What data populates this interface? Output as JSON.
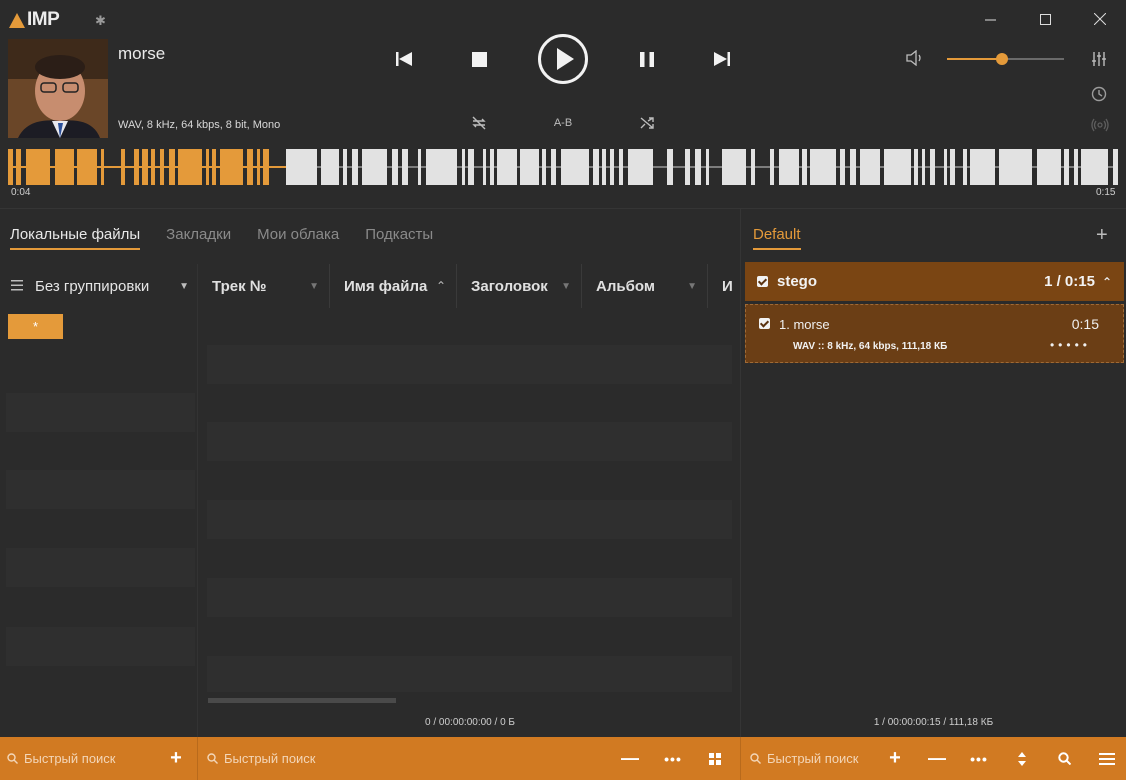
{
  "app": {
    "logo": "IMP",
    "window_controls": [
      "minimize",
      "maximize",
      "close"
    ]
  },
  "player": {
    "title": "morse",
    "info": "WAV, 8 kHz, 64 kbps, 8 bit, Mono",
    "ab_label": "A-B",
    "time_current": "0:04",
    "time_total": "0:15",
    "progress": 0.27,
    "volume": 0.47
  },
  "library": {
    "tabs": [
      "Локальные файлы",
      "Закладки",
      "Мои облака",
      "Подкасты"
    ],
    "grouping_label": "Без группировки",
    "columns": [
      "Трек №",
      "Имя файла",
      "Заголовок",
      "Альбом",
      "Ис"
    ],
    "filter_label": "*",
    "status": "0 / 00:00:00:00 / 0 Б"
  },
  "playlist": {
    "tab": "Default",
    "group": {
      "name": "stego",
      "summary": "1 / 0:15"
    },
    "items": [
      {
        "title": "1. morse",
        "duration": "0:15",
        "info": "WAV :: 8 kHz, 64 kbps, 111,18 КБ",
        "rating": "•••••"
      }
    ],
    "status": "1 / 00:00:00:15 / 111,18 КБ"
  },
  "bottom": {
    "search_placeholder_1": "Быстрый поиск",
    "search_placeholder_2": "Быстрый поиск",
    "search_placeholder_3": "Быстрый поиск"
  },
  "colors": {
    "accent": "#e49a3a",
    "bar": "#d17a22",
    "background": "#2b2b2b"
  }
}
